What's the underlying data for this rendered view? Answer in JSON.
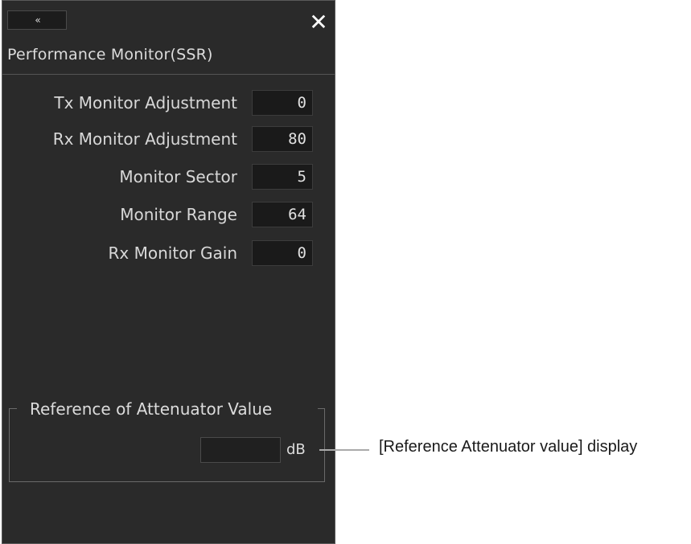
{
  "window": {
    "collapse_icon": "«",
    "close_icon": "✕",
    "title": "Performance Monitor(SSR)"
  },
  "params": [
    {
      "label": "Tx Monitor Adjustment",
      "value": "0"
    },
    {
      "label": "Rx Monitor Adjustment",
      "value": "80"
    },
    {
      "label": "Monitor Sector",
      "value": "5"
    },
    {
      "label": "Monitor Range",
      "value": "64"
    },
    {
      "label": "Rx Monitor Gain",
      "value": "0"
    }
  ],
  "attenuator": {
    "group_title": "Reference of Attenuator Value",
    "value": "",
    "unit": "dB"
  },
  "callout": {
    "text": "[Reference Attenuator value] display"
  }
}
